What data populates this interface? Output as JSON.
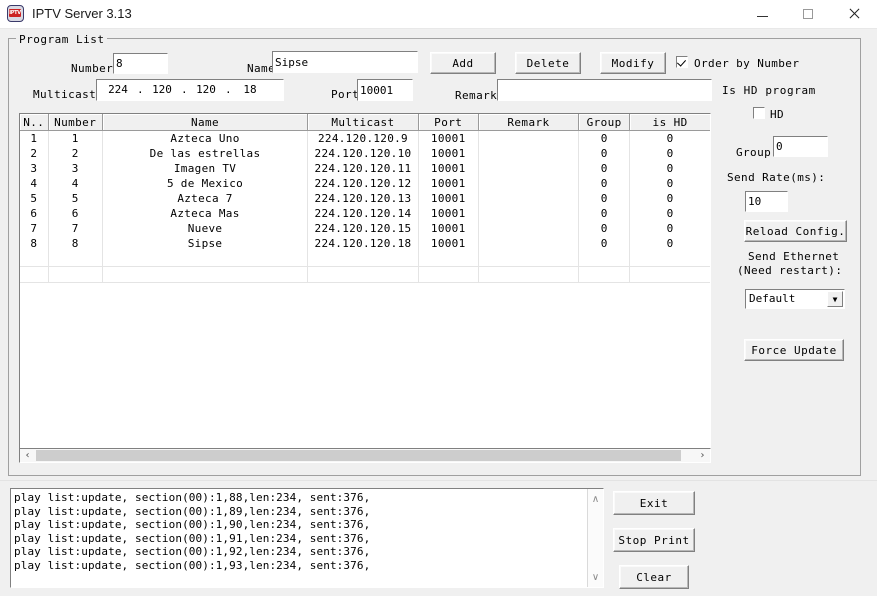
{
  "window": {
    "title": "IPTV Server 3.13",
    "icon": "iptv-app-icon",
    "icon_text": "IPTV",
    "minimize": "—",
    "maximize": "□",
    "close": "✕"
  },
  "program_list": {
    "group_label": "Program List",
    "number_label": "Number",
    "number_value": "8",
    "name_label": "Name",
    "name_value": "Sipse",
    "multicast_label": "Multicast",
    "multicast": {
      "o1": "224",
      "o2": "120",
      "o3": "120",
      "o4": "18",
      "sep": "."
    },
    "port_label": "Port",
    "port_value": "10001",
    "remark_label": "Remark",
    "remark_value": "",
    "buttons": {
      "add": "Add",
      "delete": "Delete",
      "modify": "Modify"
    },
    "order_by_number": {
      "label": "Order by Number",
      "checked": true
    }
  },
  "side_panel": {
    "is_hd_program_label": "Is HD program",
    "hd_checkbox_label": "HD",
    "hd_checked": false,
    "group_label": "Group",
    "group_value": "0",
    "send_rate_label": "Send Rate(ms):",
    "send_rate_value": "10",
    "reload_config": "Reload Config.",
    "send_ethernet_label_1": "Send Ethernet",
    "send_ethernet_label_2": "(Need restart):",
    "ethernet_selected": "Default",
    "ethernet_options": [
      "Default"
    ],
    "dropdown_arrow": "▼",
    "force_update": "Force Update"
  },
  "table": {
    "columns": [
      "N..",
      "Number",
      "Name",
      "Multicast",
      "Port",
      "Remark",
      "Group",
      "is HD"
    ],
    "rows": [
      [
        "1",
        "1",
        "Azteca Uno",
        "224.120.120.9",
        "10001",
        "",
        "0",
        "0"
      ],
      [
        "2",
        "2",
        "De las estrellas",
        "224.120.120.10",
        "10001",
        "",
        "0",
        "0"
      ],
      [
        "3",
        "3",
        "Imagen TV",
        "224.120.120.11",
        "10001",
        "",
        "0",
        "0"
      ],
      [
        "4",
        "4",
        "5 de Mexico",
        "224.120.120.12",
        "10001",
        "",
        "0",
        "0"
      ],
      [
        "5",
        "5",
        "Azteca 7",
        "224.120.120.13",
        "10001",
        "",
        "0",
        "0"
      ],
      [
        "6",
        "6",
        "Azteca Mas",
        "224.120.120.14",
        "10001",
        "",
        "0",
        "0"
      ],
      [
        "7",
        "7",
        "Nueve",
        "224.120.120.15",
        "10001",
        "",
        "0",
        "0"
      ],
      [
        "8",
        "8",
        "Sipse",
        "224.120.120.18",
        "10001",
        "",
        "0",
        "0"
      ]
    ],
    "hscroll": {
      "left_arrow": "‹",
      "right_arrow": "›"
    }
  },
  "log": {
    "text": "play list:update, section(00):1,88,len:234, sent:376,\nplay list:update, section(00):1,89,len:234, sent:376,\nplay list:update, section(00):1,90,len:234, sent:376,\nplay list:update, section(00):1,91,len:234, sent:376,\nplay list:update, section(00):1,92,len:234, sent:376,\nplay list:update, section(00):1,93,len:234, sent:376,",
    "scroll_up": "∧",
    "scroll_down": "∨"
  },
  "bottom_buttons": {
    "exit": "Exit",
    "stop_print": "Stop Print",
    "clear": "Clear"
  },
  "colors": {
    "window_bg": "#f0f0f0",
    "titlebar_bg": "#ffffff",
    "field_bg": "#ffffff",
    "accent_icon_red": "#cc2222",
    "scroll_thumb": "#cdcdcd"
  }
}
